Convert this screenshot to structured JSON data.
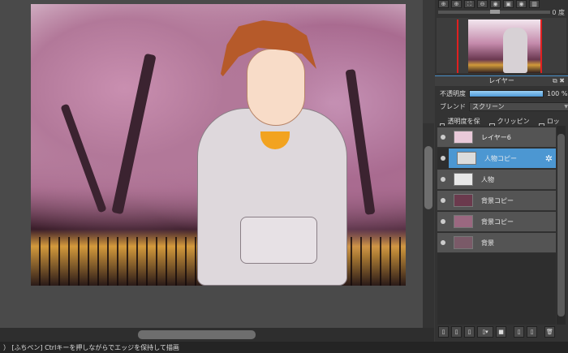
{
  "toolbar": {
    "icons": [
      "zoom-fit-icon",
      "zoom-in-icon",
      "fit-window-icon",
      "zoom-out-icon",
      "rotate-left-icon",
      "flip-icon",
      "rotate-right-icon",
      "layout-icon"
    ],
    "glyphs": [
      "⊕",
      "⊕",
      "⛶",
      "⊖",
      "◉",
      "▣",
      "◉",
      "▥"
    ]
  },
  "navigator": {
    "rotation": "0 度"
  },
  "layer_panel": {
    "title": "レイヤー",
    "opacity_label": "不透明度",
    "opacity_value": "100 %",
    "opacity_percent": 100,
    "blend_label": "ブレンド",
    "blend_value": "スクリーン",
    "checkboxes": [
      {
        "label": "透明度を保護",
        "checked": false
      },
      {
        "label": "クリッピング",
        "checked": false
      },
      {
        "label": "ロック",
        "checked": false
      }
    ],
    "layers": [
      {
        "name": "レイヤー6",
        "active": false,
        "thumb": "#e9c9d9"
      },
      {
        "name": "人物コピー",
        "active": true,
        "thumb": "#dcdcdc"
      },
      {
        "name": "人物",
        "active": false,
        "thumb": "#e8e8e8"
      },
      {
        "name": "背景コピー",
        "active": false,
        "thumb": "#6b3a4d"
      },
      {
        "name": "背景コピー",
        "active": false,
        "thumb": "#9a6880"
      },
      {
        "name": "背景",
        "active": false,
        "thumb": "#7a5a68"
      }
    ],
    "bottom_glyphs": [
      "▯",
      "▯",
      "▯",
      "▯▾",
      "■",
      "▯",
      "▯",
      "🗑"
    ]
  },
  "status": {
    "text": "） [ふちペン] Ctrlキーを押しながらでエッジを保持して描画"
  }
}
